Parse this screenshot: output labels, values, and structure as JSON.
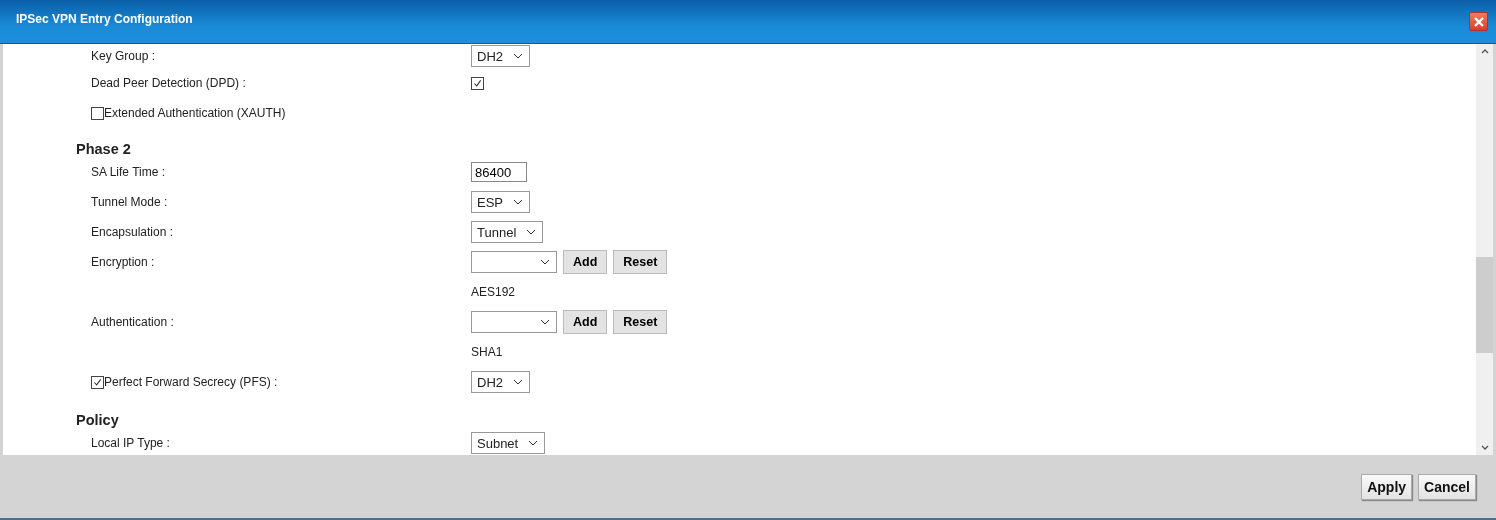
{
  "window": {
    "title": "IPSec VPN Entry Configuration"
  },
  "rows": [
    {
      "kind": "select",
      "label": "Key Group :",
      "value": "DH2"
    },
    {
      "kind": "checkbox",
      "label": "Dead Peer Detection (DPD) :",
      "checked": true
    },
    {
      "kind": "check-label",
      "label": "Extended Authentication (XAUTH)",
      "checked": false
    },
    {
      "kind": "heading",
      "label": "Phase 2"
    },
    {
      "kind": "text-input",
      "label": "SA Life Time :",
      "value": "86400"
    },
    {
      "kind": "select",
      "label": "Tunnel Mode :",
      "value": "ESP"
    },
    {
      "kind": "select",
      "label": "Encapsulation :",
      "value": "Tunnel"
    },
    {
      "kind": "select-buttons",
      "label": "Encryption :",
      "buttons": [
        "Add",
        "Reset"
      ]
    },
    {
      "kind": "value-text",
      "value": "AES192"
    },
    {
      "kind": "select-buttons",
      "label": "Authentication :",
      "buttons": [
        "Add",
        "Reset"
      ]
    },
    {
      "kind": "value-text",
      "value": "SHA1"
    },
    {
      "kind": "check-select",
      "label": "Perfect Forward Secrecy (PFS) :",
      "checked": true,
      "value": "DH2"
    },
    {
      "kind": "heading",
      "label": "Policy"
    },
    {
      "kind": "select",
      "label": "Local IP Type :",
      "value": "Subnet"
    }
  ],
  "buttons": [
    "Apply",
    "Cancel"
  ]
}
